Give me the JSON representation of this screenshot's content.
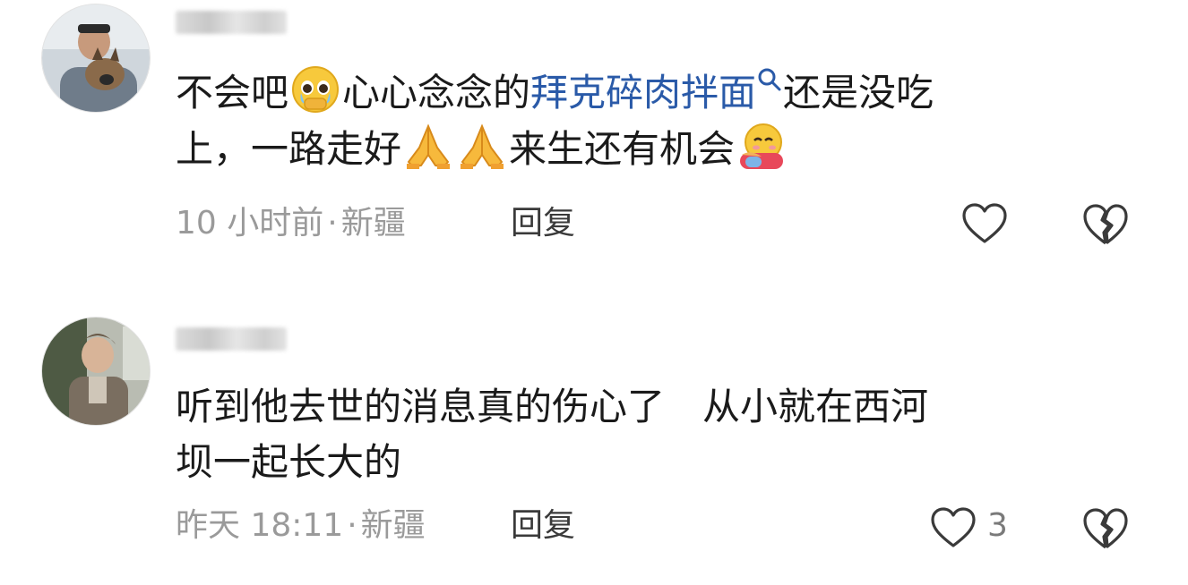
{
  "comments": [
    {
      "avatar_icon": "avatar-man-with-dog",
      "username_blurred": true,
      "line1": {
        "pre": "不会吧",
        "emoji1": "pleading-face-emoji",
        "mid": "心心念念的",
        "link": "拜克碎肉拌面",
        "link_icon": "search-icon",
        "post": "还是没吃"
      },
      "line2": {
        "pre": "上，一路走好",
        "emoji2": "folded-hands-emoji",
        "emoji3": "folded-hands-emoji",
        "mid": "来生还有机会",
        "emoji4": "hugging-face-emoji"
      },
      "time": "10 小时前",
      "dot": "·",
      "location": "新疆",
      "reply": "回复",
      "like_icon": "heart-icon",
      "dislike_icon": "broken-heart-icon"
    },
    {
      "avatar_icon": "avatar-elderly-person",
      "username_blurred": true,
      "line1": "听到他去世的消息真的伤心了　从小就在西河",
      "line2": "坝一起长大的",
      "time": "昨天 18:11",
      "dot": "·",
      "location": "新疆",
      "reply": "回复",
      "like_count": "3",
      "like_icon": "heart-icon",
      "dislike_icon": "broken-heart-icon"
    }
  ],
  "colors": {
    "text": "#1a1a1a",
    "link": "#2a5aa8",
    "meta": "#9a9a9a",
    "icon": "#3a3a3a"
  }
}
